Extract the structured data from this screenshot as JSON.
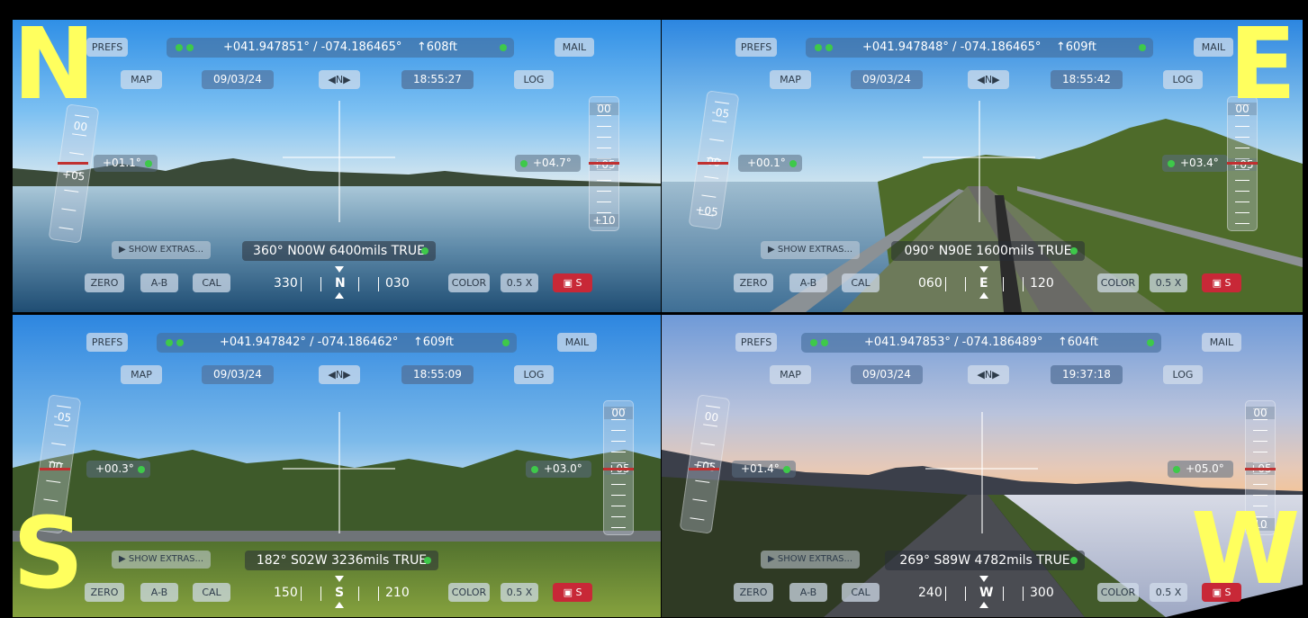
{
  "panels": [
    {
      "direction_letter": "N",
      "prefs": "PREFS",
      "mail": "MAIL",
      "map": "MAP",
      "log": "LOG",
      "date": "09/03/24",
      "time": "18:55:27",
      "coords": "+041.947851° / -074.186465°",
      "altitude": "↑608ft",
      "nav_toggle": "◀N▶",
      "tilt_left": "+01.1°",
      "tilt_right": "+04.7°",
      "heading": "360° N00W  6400mils  TRUE",
      "show_extras": "▶ SHOW EXTRAS...",
      "zero": "ZERO",
      "ab": "A-B",
      "cal": "CAL",
      "color": "COLOR",
      "zoom": "0.5 X",
      "cam_label": "S",
      "compass_left": "330",
      "compass_center": "N",
      "compass_right": "030",
      "scale_labels": [
        "00",
        "+05",
        "+10"
      ],
      "arc_labels": [
        "00",
        "+05"
      ]
    },
    {
      "direction_letter": "E",
      "prefs": "PREFS",
      "mail": "MAIL",
      "map": "MAP",
      "log": "LOG",
      "date": "09/03/24",
      "time": "18:55:42",
      "coords": "+041.947848° / -074.186465°",
      "altitude": "↑609ft",
      "nav_toggle": "◀N▶",
      "tilt_left": "+00.1°",
      "tilt_right": "+03.4°",
      "heading": "090° N90E  1600mils  TRUE",
      "show_extras": "▶ SHOW EXTRAS...",
      "zero": "ZERO",
      "ab": "A-B",
      "cal": "CAL",
      "color": "COLOR",
      "zoom": "0.5 X",
      "cam_label": "S",
      "compass_left": "060",
      "compass_center": "E",
      "compass_right": "120",
      "scale_labels": [
        "00",
        "+05"
      ],
      "arc_labels": [
        "-05",
        "00",
        "+05"
      ]
    },
    {
      "direction_letter": "S",
      "prefs": "PREFS",
      "mail": "MAIL",
      "map": "MAP",
      "log": "LOG",
      "date": "09/03/24",
      "time": "18:55:09",
      "coords": "+041.947842° / -074.186462°",
      "altitude": "↑609ft",
      "nav_toggle": "◀N▶",
      "tilt_left": "+00.3°",
      "tilt_right": "+03.0°",
      "heading": "182° S02W  3236mils  TRUE",
      "show_extras": "▶ SHOW EXTRAS...",
      "zero": "ZERO",
      "ab": "A-B",
      "cal": "CAL",
      "color": "COLOR",
      "zoom": "0.5 X",
      "cam_label": "S",
      "compass_left": "150",
      "compass_center": "S",
      "compass_right": "210",
      "scale_labels": [
        "00",
        "+05"
      ],
      "arc_labels": [
        "-05",
        "00"
      ]
    },
    {
      "direction_letter": "W",
      "prefs": "PREFS",
      "mail": "MAIL",
      "map": "MAP",
      "log": "LOG",
      "date": "09/03/24",
      "time": "19:37:18",
      "coords": "+041.947853° / -074.186489°",
      "altitude": "↑604ft",
      "nav_toggle": "◀N▶",
      "tilt_left": "+01.4°",
      "tilt_right": "+05.0°",
      "heading": "269° S89W  4782mils  TRUE",
      "show_extras": "▶ SHOW EXTRAS...",
      "zero": "ZERO",
      "ab": "A-B",
      "cal": "CAL",
      "color": "COLOR",
      "zoom": "0.5 X",
      "cam_label": "S",
      "compass_left": "240",
      "compass_center": "W",
      "compass_right": "300",
      "scale_labels": [
        "00",
        "+05",
        "10"
      ],
      "arc_labels": [
        "00",
        "+05"
      ]
    }
  ],
  "colors": {
    "letter": "#ffff5e",
    "status_dot": "#3ec94a",
    "camera_button": "#c82837"
  }
}
